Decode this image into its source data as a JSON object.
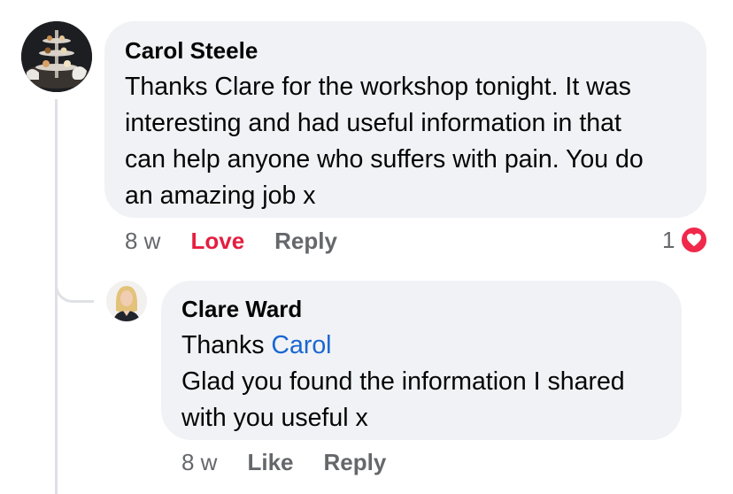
{
  "comments": [
    {
      "author": "Carol Steele",
      "lines": [
        "Thanks Clare for the workshop tonight. It was",
        "interesting and had useful information in that",
        "can help anyone who suffers with pain. You do",
        "an amazing job x"
      ],
      "time": "8 w",
      "reaction_label": "Love",
      "reply_label": "Reply",
      "reaction_count": "1",
      "reaction_icon": "heart-icon"
    },
    {
      "author": "Clare Ward",
      "thanks_prefix": "Thanks ",
      "mention": "Carol",
      "lines": [
        "Glad you found the information I shared",
        "with you useful x"
      ],
      "time": "8 w",
      "like_label": "Like",
      "reply_label": "Reply"
    }
  ],
  "colors": {
    "bubble": "#f0f2f5",
    "meta_text": "#65676b",
    "love": "#e41e3f",
    "mention": "#1a66d2",
    "heart_badge": "#f0284a"
  }
}
